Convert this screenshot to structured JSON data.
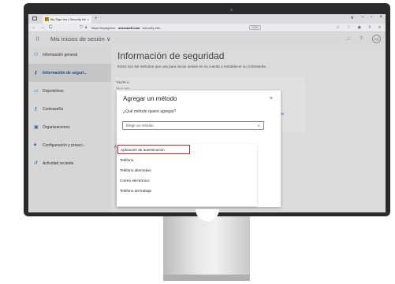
{
  "browser": {
    "tab_title": "My Sign-Ins | Security Info | Mi",
    "new_tab": "+",
    "window_controls": [
      "∨",
      "−",
      "▫",
      "×"
    ],
    "nav_back": "←",
    "nav_forward": "→",
    "nav_reload": "C",
    "url_prefix": "https://mysignins.",
    "url_domain": "microsoft.com",
    "url_suffix": "/security-info",
    "zoom": "120%",
    "icons": [
      "star-icon",
      "shield-icon",
      "account-icon",
      "share-icon",
      "menu-icon"
    ]
  },
  "app": {
    "title": "Mis inicios de sesión",
    "title_chevron": "∨",
    "avatar": "LQ",
    "help": "?"
  },
  "sidebar": {
    "items": [
      {
        "label": "Información general",
        "icon": "person-icon"
      },
      {
        "label": "Información de seguri...",
        "icon": "key-icon",
        "active": true
      },
      {
        "label": "Dispositivos",
        "icon": "laptop-icon"
      },
      {
        "label": "Contraseña",
        "icon": "password-key-icon"
      },
      {
        "label": "Organizaciones",
        "icon": "briefcase-icon"
      },
      {
        "label": "Configuración y privaci...",
        "icon": "lock-icon"
      },
      {
        "label": "Actividad reciente",
        "icon": "history-icon"
      }
    ]
  },
  "main": {
    "title": "Información de seguridad",
    "subtitle": "Estos son los métodos que usa para iniciar sesión en su cuenta o restablecer su contraseña.",
    "card_line1": "You're u",
    "card_line2": "Sign-in meth",
    "card_add": "+ Agr",
    "card_phone": "☎",
    "card_link": "eliminar",
    "lost_device": "¿Perdiste"
  },
  "modal": {
    "title": "Agregar un método",
    "close": "×",
    "question": "¿Qué método quiere agregar?",
    "select_value": "Elegir un método",
    "select_chevron": "∨",
    "options": [
      "Aplicación de autenticación",
      "Teléfono",
      "Teléfono alternativo",
      "Correo electrónico",
      "Teléfono del trabajo"
    ],
    "highlight_color": "#d32027"
  }
}
